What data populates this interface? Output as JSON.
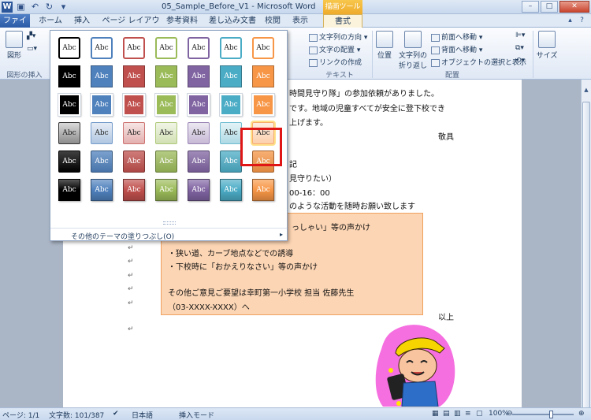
{
  "window": {
    "title": "05_Sample_Before_V1 - Microsoft Word",
    "context_tool": "描画ツール",
    "minimize": "–",
    "maximize": "□",
    "close": "✕"
  },
  "tabs": [
    {
      "label": "ファイル",
      "id": "file"
    },
    {
      "label": "ホーム",
      "id": "home"
    },
    {
      "label": "挿入",
      "id": "insert"
    },
    {
      "label": "ページ レイアウト",
      "id": "page-layout"
    },
    {
      "label": "参考資料",
      "id": "references"
    },
    {
      "label": "差し込み文書",
      "id": "mailings"
    },
    {
      "label": "校閲",
      "id": "review"
    },
    {
      "label": "表示",
      "id": "view"
    },
    {
      "label": "書式",
      "id": "format"
    }
  ],
  "ribbon": {
    "group_insert_shapes": "図形の挿入",
    "shapes_label": "図形",
    "group_text": "テキスト",
    "text_direction": "文字列の方向",
    "text_align": "文字の配置",
    "create_link": "リンクの作成",
    "group_arrange": "配置",
    "position": "位置",
    "wrap_text_line1": "文字列の",
    "wrap_text_line2": "折り返し",
    "bring_forward": "前面へ移動",
    "send_backward": "背面へ移動",
    "selection_pane": "オブジェクトの選択と表示",
    "size": "サイズ"
  },
  "gallery": {
    "swatch_label": "Abc",
    "footer_label": "その他のテーマの塗りつぶし(O)",
    "colors": [
      "#000000",
      "#4f81bd",
      "#c0504d",
      "#9bbb59",
      "#8064a2",
      "#4bacc6",
      "#f79646"
    ],
    "selected_row": 3,
    "selected_col": 6
  },
  "document": {
    "lines": [
      "時間見守り隊」の参加依頼がありました。",
      "です。地域の児童すべてが安全に登下校でき",
      "上げます。",
      "敬具",
      "記",
      "見守りたい）",
      "00-16：00",
      "のような活動を随時お願い致します",
      "っしゃい」等の声かけ",
      "・狭い道、カーブ地点などでの誘導",
      "・下校時に「おかえりなさい」等の声かけ",
      "その他ご意見ご要望は幸町第一小学校 担当 佐藤先生",
      "（03-XXXX-XXXX）へ",
      "以上"
    ]
  },
  "status": {
    "page": "ページ: 1/1",
    "words": "文字数: 101/387",
    "language": "日本語",
    "mode": "挿入モード",
    "zoom": "100%"
  }
}
